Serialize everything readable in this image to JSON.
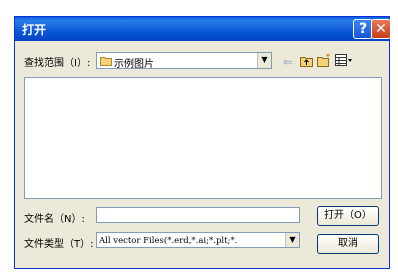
{
  "dialog": {
    "title": "打开",
    "help_label": "?",
    "close_label": "✕"
  },
  "lookin": {
    "label": "查找范围（I）:",
    "value": "示例图片"
  },
  "toolbar": {
    "icons": [
      "back-icon",
      "up-folder-icon",
      "new-folder-icon",
      "view-menu-icon"
    ]
  },
  "filename": {
    "label": "文件名（N）:",
    "value": ""
  },
  "filetype": {
    "label": "文件类型（T）:",
    "value": "All vector Files(*.erd,*.ai;*.plt;*."
  },
  "buttons": {
    "open": "打开（O）",
    "cancel": "取消"
  }
}
